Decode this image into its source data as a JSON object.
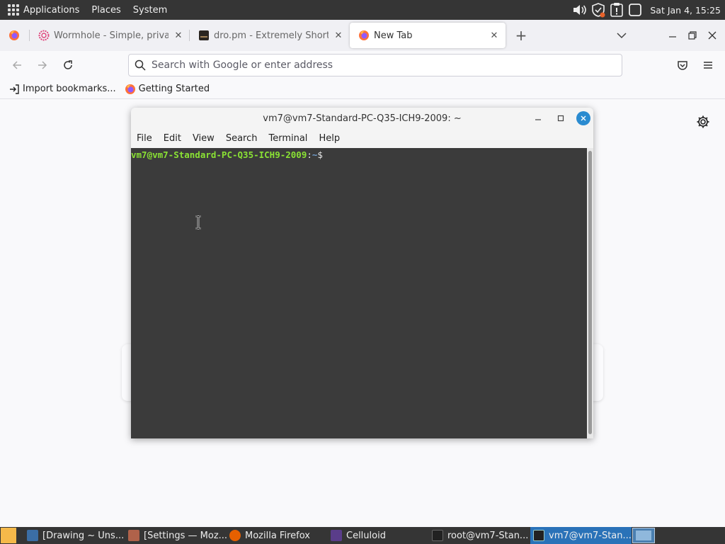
{
  "top_panel": {
    "menus": [
      "Applications",
      "Places",
      "System"
    ],
    "clock": "Sat Jan  4, 15:25",
    "tray_icons": [
      "volume-icon",
      "security-shield-icon",
      "update-notifier-icon",
      "window-icon"
    ]
  },
  "browser": {
    "tabs": [
      {
        "title": "",
        "favicon": "firefox-icon",
        "pinned": true
      },
      {
        "title": "Wormhole - Simple, private",
        "favicon": "wormhole-icon"
      },
      {
        "title": "dro.pm - Extremely Short Li",
        "favicon": "dropm-icon"
      },
      {
        "title": "New Tab",
        "favicon": "firefox-icon",
        "active": true
      }
    ],
    "new_tab_symbol": "+",
    "close_symbol": "✕",
    "url_placeholder": "Search with Google or enter address",
    "bookmarks": [
      {
        "label": "Import bookmarks...",
        "icon": "import-icon"
      },
      {
        "label": "Getting Started",
        "icon": "firefox-icon"
      }
    ]
  },
  "terminal": {
    "title": "vm7@vm7-Standard-PC-Q35-ICH9-2009: ~",
    "menus": [
      "File",
      "Edit",
      "View",
      "Search",
      "Terminal",
      "Help"
    ],
    "prompt_user": "vm7@vm7-Standard-PC-Q35-ICH9-2009",
    "prompt_sep": ":",
    "prompt_path": "~",
    "prompt_symbol": "$"
  },
  "taskbar": {
    "items": [
      {
        "label": "[Drawing ~ Uns...",
        "icon": "drawing-icon",
        "color": "#3b6ea5"
      },
      {
        "label": "[Settings — Moz...",
        "icon": "firefox-settings-icon",
        "color": "#b0624a"
      },
      {
        "label": "Mozilla Firefox",
        "icon": "firefox-icon",
        "color": "#e66000"
      },
      {
        "label": "Celluloid",
        "icon": "celluloid-icon",
        "color": "#5a3d8a"
      },
      {
        "label": "root@vm7-Stan...",
        "icon": "terminal-icon",
        "color": "#222222"
      },
      {
        "label": "vm7@vm7-Stan...",
        "icon": "terminal-icon",
        "color": "#222222",
        "active": true
      }
    ]
  }
}
